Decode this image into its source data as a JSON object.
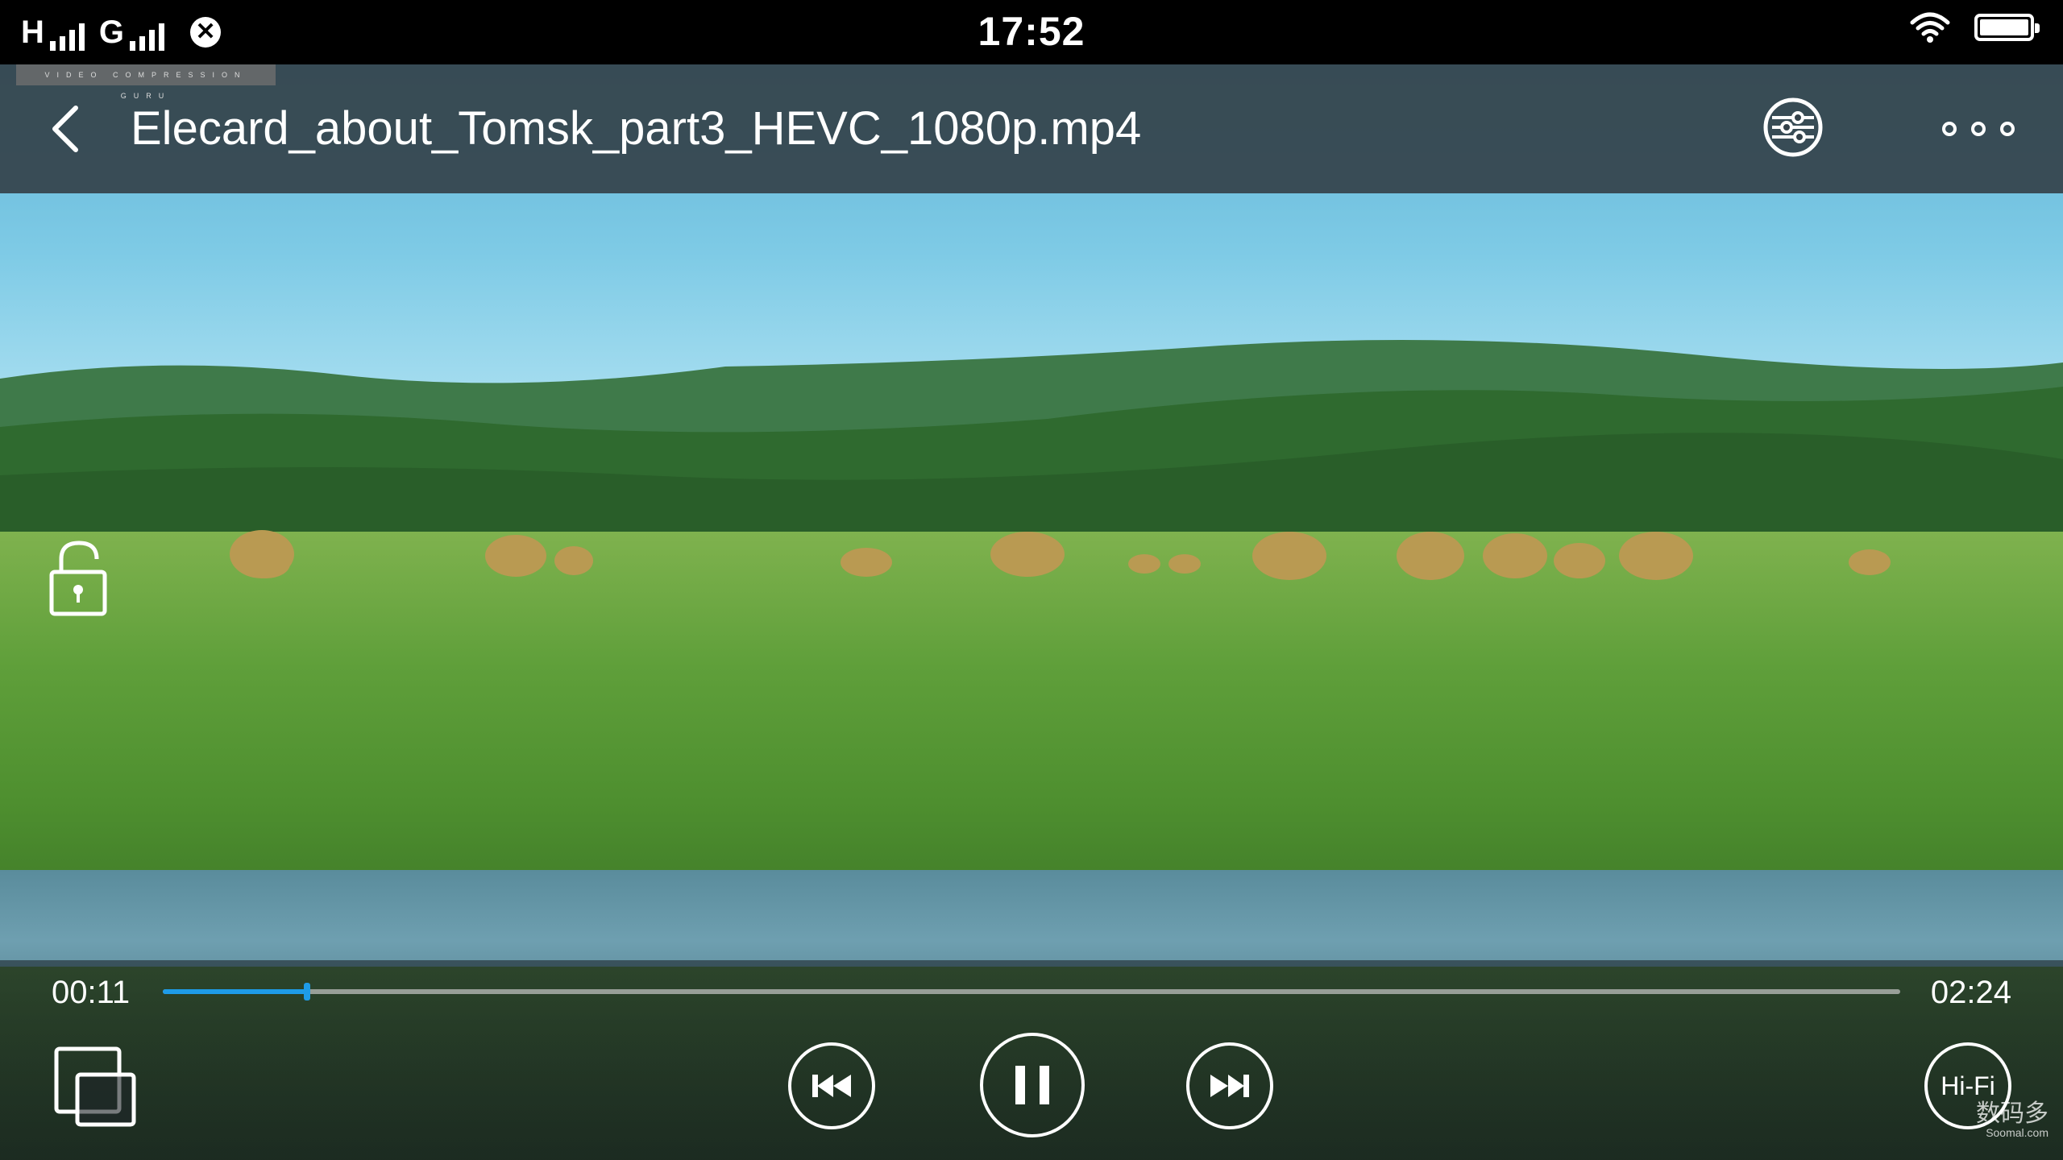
{
  "status_bar": {
    "network_1": "H",
    "network_2": "G",
    "time": "17:52"
  },
  "header": {
    "watermark": "VIDEO COMPRESSION GURU",
    "title": "Elecard_about_Tomsk_part3_HEVC_1080p.mp4"
  },
  "player": {
    "current_time": "00:11",
    "duration": "02:24",
    "progress_fraction": 0.083,
    "accent_color": "#1e9be8",
    "hifi_label": "Hi-Fi"
  },
  "watermark_site": {
    "name": "数码多",
    "url": "Soomal.com"
  },
  "icons": [
    "back-icon",
    "share-icon",
    "more-icon",
    "unlock-icon",
    "pip-icon",
    "previous-icon",
    "pause-icon",
    "next-icon",
    "wifi-icon",
    "battery-icon",
    "close-circle-icon"
  ]
}
